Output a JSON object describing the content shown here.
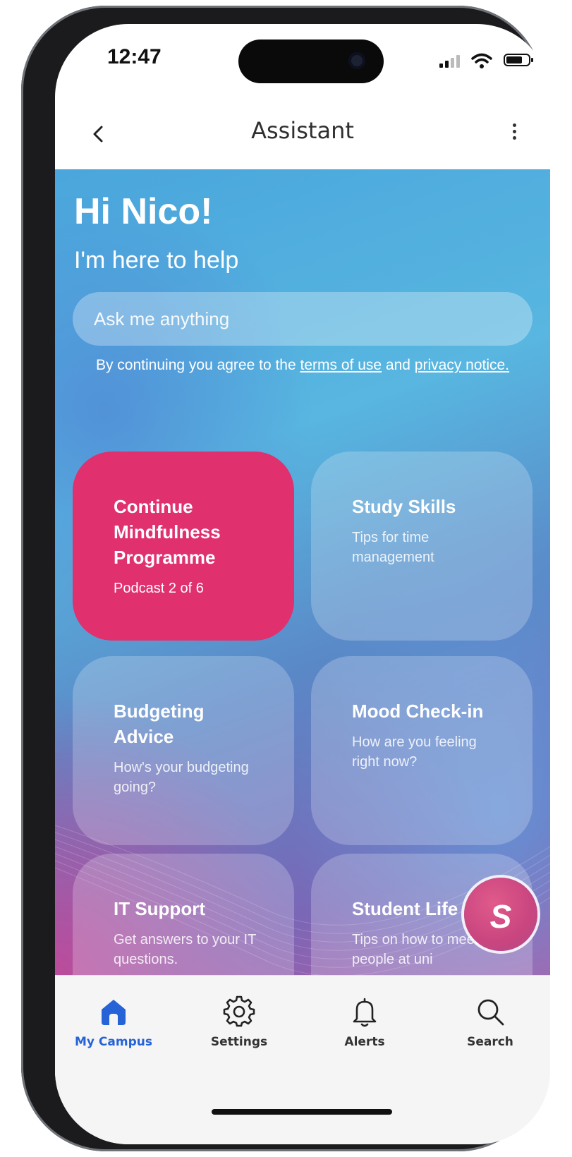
{
  "status_bar": {
    "time": "12:47"
  },
  "header": {
    "title": "Assistant",
    "back_icon": "chevron-left-icon",
    "more_icon": "more-vertical-icon"
  },
  "hero": {
    "greeting": "Hi Nico!",
    "subtitle": "I'm here to help"
  },
  "search": {
    "placeholder": "Ask me anything"
  },
  "consent": {
    "prefix": "By continuing you agree to the",
    "terms_link": "terms of use",
    "middle": "and",
    "privacy_link": "privacy notice."
  },
  "cards": [
    {
      "title": "Continue Mindfulness Programme",
      "subtitle": "Podcast 2 of 6",
      "color": "#e0306e"
    },
    {
      "title": "Study Skills",
      "subtitle": "Tips for time management"
    },
    {
      "title": "Budgeting Advice",
      "subtitle": "How's your budgeting going?"
    },
    {
      "title": "Mood Check-in",
      "subtitle": "How are you feeling right now?"
    },
    {
      "title": "IT Support",
      "subtitle": "Get answers to your IT questions."
    },
    {
      "title": "Student Life",
      "subtitle": "Tips on how to meet people at uni"
    }
  ],
  "fab": {
    "label": "S",
    "icon": "assistant-logo-icon"
  },
  "tabs": [
    {
      "label": "My Campus",
      "icon": "home-icon",
      "active": true
    },
    {
      "label": "Settings",
      "icon": "gear-icon",
      "active": false
    },
    {
      "label": "Alerts",
      "icon": "bell-icon",
      "active": false
    },
    {
      "label": "Search",
      "icon": "search-icon",
      "active": false
    }
  ],
  "colors": {
    "accent_blue": "#2563d6",
    "card_pink": "#e0306e",
    "fab_pink": "#c9457f"
  }
}
